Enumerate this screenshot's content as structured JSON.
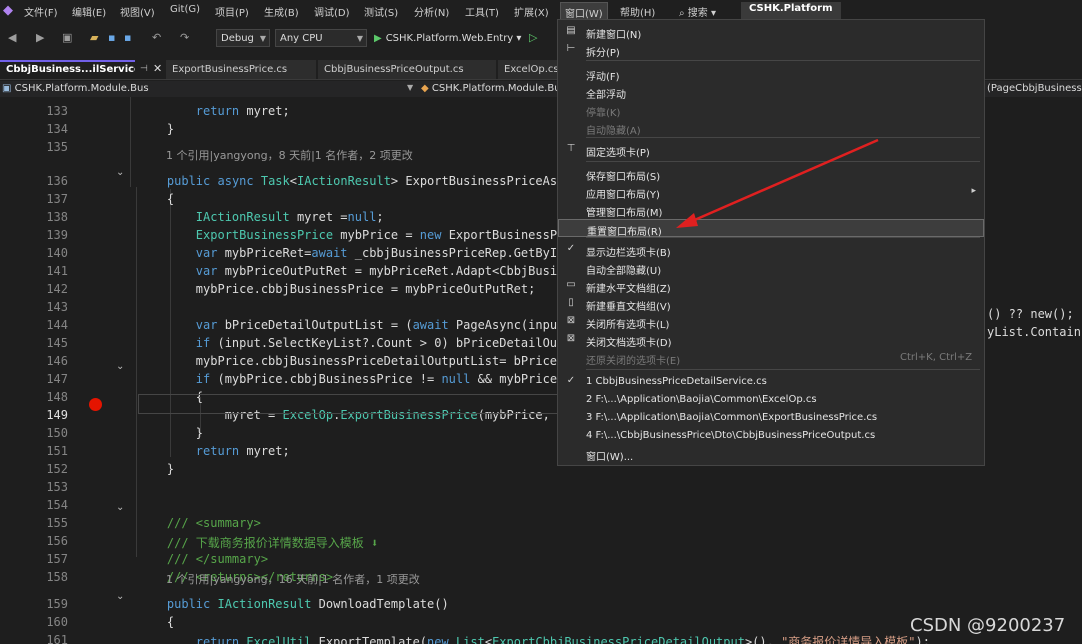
{
  "menubar": {
    "items": [
      "文件(F)",
      "编辑(E)",
      "视图(V)",
      "Git(G)",
      "项目(P)",
      "生成(B)",
      "调试(D)",
      "测试(S)",
      "分析(N)",
      "工具(T)",
      "扩展(X)",
      "窗口(W)",
      "帮助(H)"
    ],
    "search": "搜索",
    "solution": "CSHK.Platform"
  },
  "toolbar": {
    "config": "Debug",
    "platform": "Any CPU",
    "startup": "CSHK.Platform.Web.Entry"
  },
  "tabs": [
    "CbbjBusiness...ilService.cs",
    "ExportBusinessPrice.cs",
    "CbbjBusinessPriceOutput.cs",
    "ExcelOp.cs"
  ],
  "navbar": {
    "project": "CSHK.Platform.Module.Bus",
    "class": "CSHK.Platform.Module.Bu",
    "member": "(PageCbbjBusinessPr"
  },
  "editor": {
    "lines": [
      {
        "n": "133",
        "text": "        return myret;"
      },
      {
        "n": "134",
        "text": "    }"
      },
      {
        "n": "135",
        "text": ""
      },
      {
        "n": "136",
        "text": "    public async Task<IActionResult> ExportBusinessPriceAsync"
      },
      {
        "n": "137",
        "text": "    {"
      },
      {
        "n": "138",
        "text": "        IActionResult myret =null;"
      },
      {
        "n": "139",
        "text": "        ExportBusinessPrice mybPrice = new ExportBusinessPr"
      },
      {
        "n": "140",
        "text": "        var mybPriceRet=await _cbbjBusinessPriceRep.GetById"
      },
      {
        "n": "141",
        "text": "        var mybPriceOutPutRet = mybPriceRet.Adapt<CbbjBusin"
      },
      {
        "n": "142",
        "text": "        mybPrice.cbbjBusinessPrice = mybPriceOutPutRet;"
      },
      {
        "n": "143",
        "text": ""
      },
      {
        "n": "144",
        "text": "        var bPriceDetailOutputList = (await PageAsync(input"
      },
      {
        "n": "145",
        "text": "        if (input.SelectKeyList?.Count > 0) bPriceDetailOu"
      },
      {
        "n": "146",
        "text": "        mybPrice.cbbjBusinessPriceDetailOutputList= bPriceD"
      },
      {
        "n": "147",
        "text": "        if (mybPrice.cbbjBusinessPrice != null && mybPrice."
      },
      {
        "n": "148",
        "text": "        {"
      },
      {
        "n": "149",
        "text": "            myret = ExcelOp.ExportBusinessPrice(mybPrice,"
      },
      {
        "n": "150",
        "text": "        }"
      },
      {
        "n": "151",
        "text": "        return myret;"
      },
      {
        "n": "152",
        "text": "    }"
      },
      {
        "n": "153",
        "text": ""
      },
      {
        "n": "154",
        "text": ""
      },
      {
        "n": "155",
        "text": "    /// <summary>"
      },
      {
        "n": "156",
        "text": "    /// 下载商务报价详情数据导入模板 ⬇"
      },
      {
        "n": "157",
        "text": "    /// </summary>"
      },
      {
        "n": "158",
        "text": "    /// <returns></returns>"
      },
      {
        "n": "159",
        "text": "    public IActionResult DownloadTemplate()"
      },
      {
        "n": "160",
        "text": "    {"
      },
      {
        "n": "161",
        "text": "        return ExcelUtil.ExportTemplate(new List<ExportCbbjBusinessPriceDetailOutput>(), \"商务报价详情导入模板\");"
      }
    ],
    "lens1": "1 个引用|yangyong，8 天前|1 名作者，2 项更改",
    "lens2": "1 个引用|yangyong，16 天前|1 名作者，1 项更改",
    "right_fragments": [
      "() ?? new();",
      "yList.Contains"
    ]
  },
  "window_menu": {
    "items": [
      {
        "label": "新建窗口(N)",
        "icon": "new-window-icon",
        "enabled": true
      },
      {
        "label": "拆分(P)",
        "icon": "split-icon",
        "enabled": true
      },
      {
        "label": "浮动(F)",
        "enabled": true
      },
      {
        "label": "全部浮动",
        "enabled": true
      },
      {
        "label": "停靠(K)",
        "enabled": false
      },
      {
        "label": "自动隐藏(A)",
        "enabled": false
      },
      {
        "label": "固定选项卡(P)",
        "icon": "pin-icon",
        "enabled": true
      },
      {
        "label": "保存窗口布局(S)",
        "enabled": true
      },
      {
        "label": "应用窗口布局(Y)",
        "enabled": true,
        "submenu": true
      },
      {
        "label": "管理窗口布局(M)",
        "enabled": true
      },
      {
        "label": "重置窗口布局(R)",
        "enabled": true,
        "highlighted": true
      },
      {
        "label": "显示边栏选项卡(B)",
        "icon": "check-icon",
        "enabled": true
      },
      {
        "label": "自动全部隐藏(U)",
        "enabled": true
      },
      {
        "label": "新建水平文档组(Z)",
        "icon": "horizontal-group-icon",
        "enabled": true
      },
      {
        "label": "新建垂直文档组(V)",
        "icon": "vertical-group-icon",
        "enabled": true
      },
      {
        "label": "关闭所有选项卡(L)",
        "icon": "close-tabs-icon",
        "enabled": true
      },
      {
        "label": "关闭文档选项卡(D)",
        "icon": "close-doc-tabs-icon",
        "enabled": true
      },
      {
        "label": "还原关闭的选项卡(E)",
        "enabled": false,
        "shortcut": "Ctrl+K, Ctrl+Z"
      },
      {
        "label": "1 CbbjBusinessPriceDetailService.cs",
        "icon": "check-icon",
        "enabled": true
      },
      {
        "label": "2 F:\\...\\Application\\Baojia\\Common\\ExcelOp.cs",
        "enabled": true
      },
      {
        "label": "3 F:\\...\\Application\\Baojia\\Common\\ExportBusinessPrice.cs",
        "enabled": true
      },
      {
        "label": "4 F:\\...\\CbbjBusinessPrice\\Dto\\CbbjBusinessPriceOutput.cs",
        "enabled": true
      },
      {
        "label": "窗口(W)...",
        "enabled": true
      }
    ]
  },
  "watermark": "CSDN @9200237",
  "annotation_color": "#e02020"
}
